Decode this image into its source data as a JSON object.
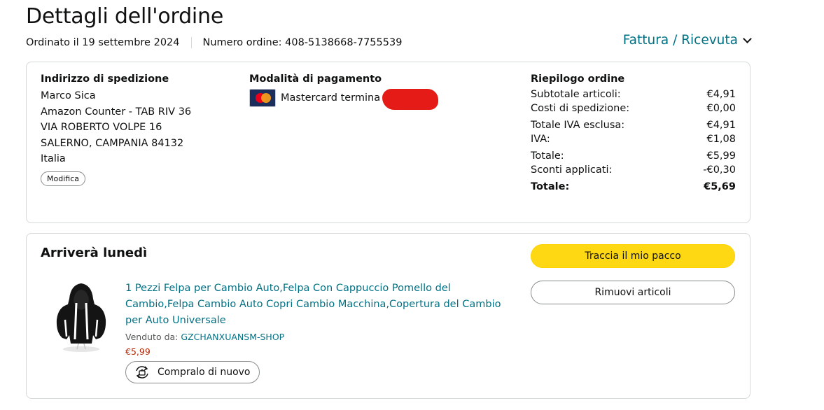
{
  "header": {
    "title": "Dettagli dell'ordine",
    "ordered_on": "Ordinato il 19 settembre 2024",
    "order_number": "Numero ordine: 408-5138668-7755539",
    "invoice_link": "Fattura / Ricevuta"
  },
  "shipping": {
    "title": "Indirizzo di spedizione",
    "lines": [
      "Marco Sica",
      "Amazon Counter - TAB RIV 36",
      "VIA ROBERTO VOLPE 16",
      "SALERNO, CAMPANIA 84132",
      "Italia"
    ],
    "edit_label": "Modifica"
  },
  "payment": {
    "title": "Modalità di pagamento",
    "card_text": "Mastercard termina",
    "card_icon": "mastercard-icon"
  },
  "summary": {
    "title": "Riepilogo ordine",
    "rows": [
      {
        "label": "Subtotale articoli:",
        "value": "€4,91"
      },
      {
        "label": "Costi di spedizione:",
        "value": "€0,00"
      },
      {
        "label": "Totale IVA esclusa:",
        "value": "€4,91"
      },
      {
        "label": "IVA:",
        "value": "€1,08"
      },
      {
        "label": "Totale:",
        "value": "€5,99"
      },
      {
        "label": "Sconti applicati:",
        "value": "-€0,30"
      },
      {
        "label": "Totale:",
        "value": "€5,69"
      }
    ]
  },
  "shipment": {
    "arrival": "Arriverà lunedì",
    "track_button": "Traccia il mio pacco",
    "remove_button": "Rimuovi articoli",
    "product": {
      "title": "1 Pezzi Felpa per Cambio Auto,Felpa Con Cappuccio Pomello del Cambio,Felpa Cambio Auto Copri Cambio Macchina,Copertura del Cambio per Auto Universale",
      "sold_by_label": "Venduto da:",
      "seller": "GZCHANXUANSM-SHOP",
      "price": "€5,99",
      "buy_again": "Compralo di nuovo"
    }
  },
  "colors": {
    "link": "#007185",
    "price": "#b12704",
    "track_button": "#ffd814",
    "border": "#d5d9d9"
  }
}
